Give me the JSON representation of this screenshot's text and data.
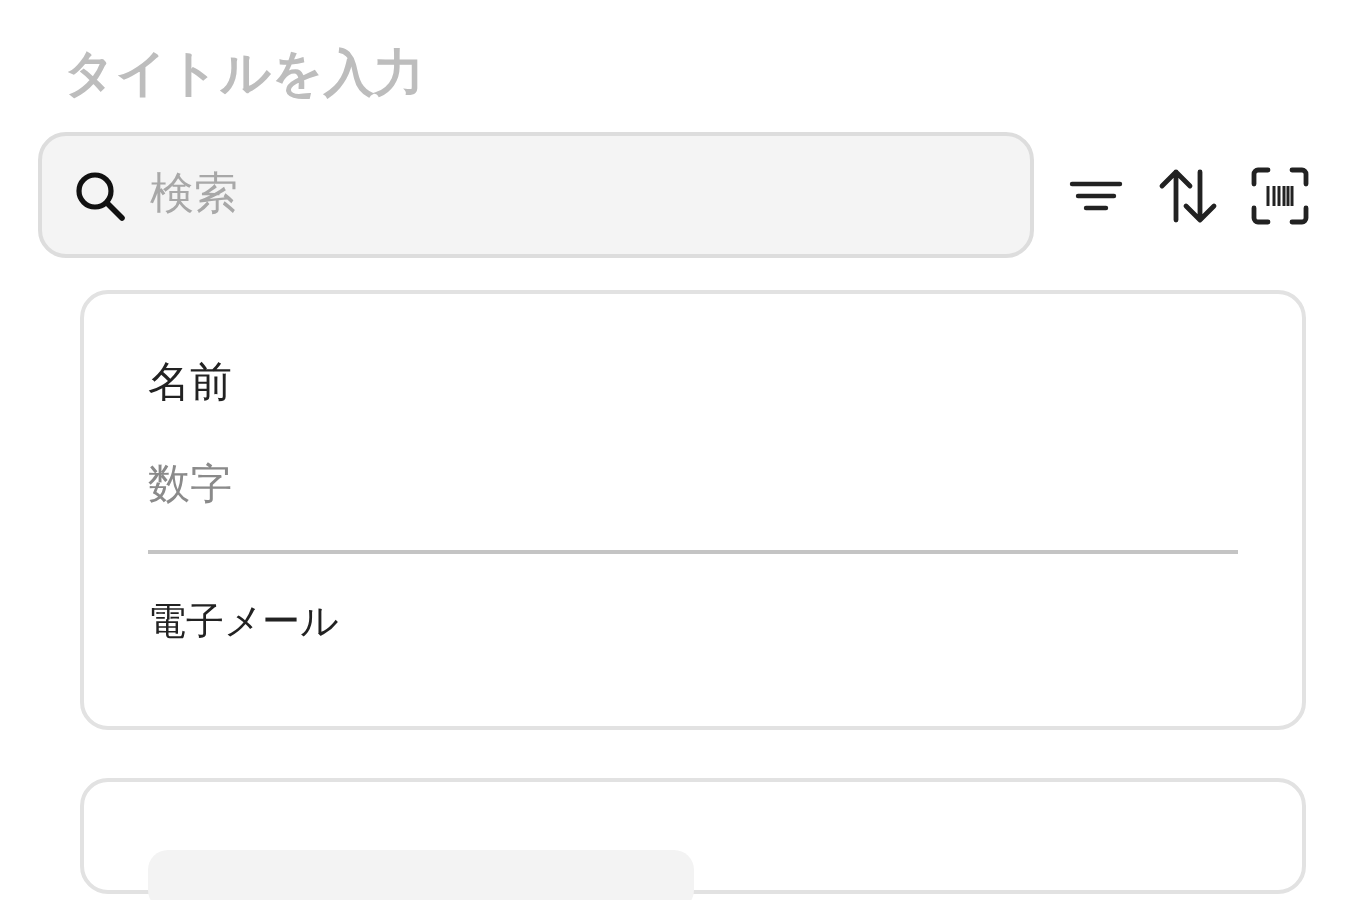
{
  "title_field": {
    "placeholder": "タイトルを入力"
  },
  "search": {
    "placeholder": "検索"
  },
  "cards": [
    {
      "kind": "fields",
      "items": [
        {
          "kind": "text",
          "text": "名前"
        },
        {
          "kind": "muted",
          "text": "数字"
        },
        {
          "kind": "divider"
        },
        {
          "kind": "small",
          "text": "電子メール"
        }
      ]
    },
    {
      "kind": "loading"
    }
  ]
}
